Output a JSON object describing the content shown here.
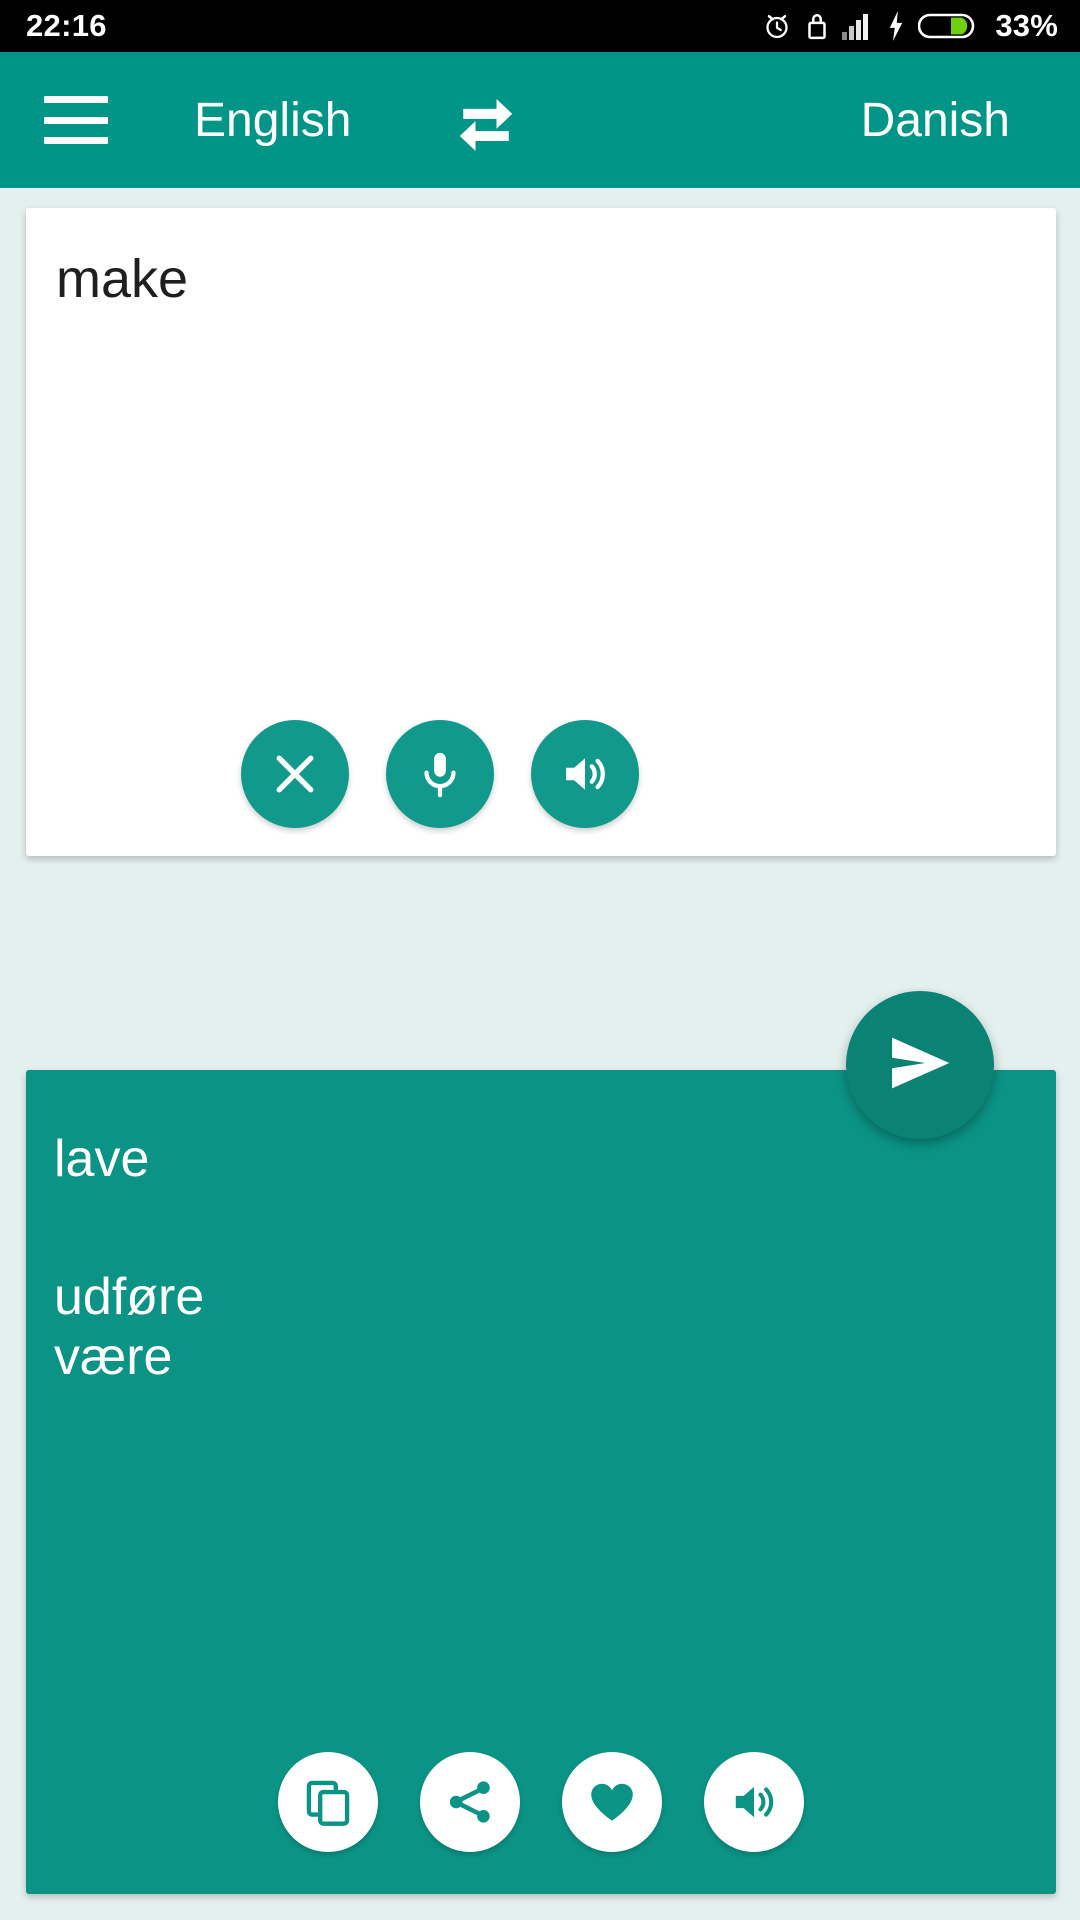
{
  "status_bar": {
    "time": "22:16",
    "battery_percent": "33%",
    "icons": [
      "alarm-icon",
      "lock-icon",
      "signal-icon",
      "charging-bolt-icon",
      "battery-icon"
    ],
    "background": "#000000",
    "foreground": "#ffffff"
  },
  "toolbar": {
    "menu_icon": "hamburger-menu-icon",
    "source_language": "English",
    "swap_icon": "swap-languages-icon",
    "target_language": "Danish",
    "background": "#019588",
    "text_color": "#ffffff"
  },
  "input_card": {
    "text": "make",
    "placeholder": "",
    "background": "#ffffff",
    "text_color": "#1f1f1f",
    "actions": [
      {
        "name": "clear-button",
        "icon": "close-icon"
      },
      {
        "name": "voice-input-button",
        "icon": "microphone-icon"
      },
      {
        "name": "speak-source-button",
        "icon": "speaker-icon"
      }
    ]
  },
  "send_button": {
    "name": "send-button",
    "icon": "send-icon",
    "background": "#0a8375"
  },
  "result_card": {
    "primary_translation": "lave",
    "alternatives": [
      "udføre",
      "være"
    ],
    "background": "#0b9486",
    "text_color": "#ffffff",
    "actions": [
      {
        "name": "copy-button",
        "icon": "copy-icon"
      },
      {
        "name": "share-button",
        "icon": "share-icon"
      },
      {
        "name": "favorite-button",
        "icon": "heart-icon"
      },
      {
        "name": "speak-result-button",
        "icon": "speaker-icon"
      }
    ]
  },
  "page": {
    "background": "#e4f0ee",
    "accent": "#019588"
  }
}
